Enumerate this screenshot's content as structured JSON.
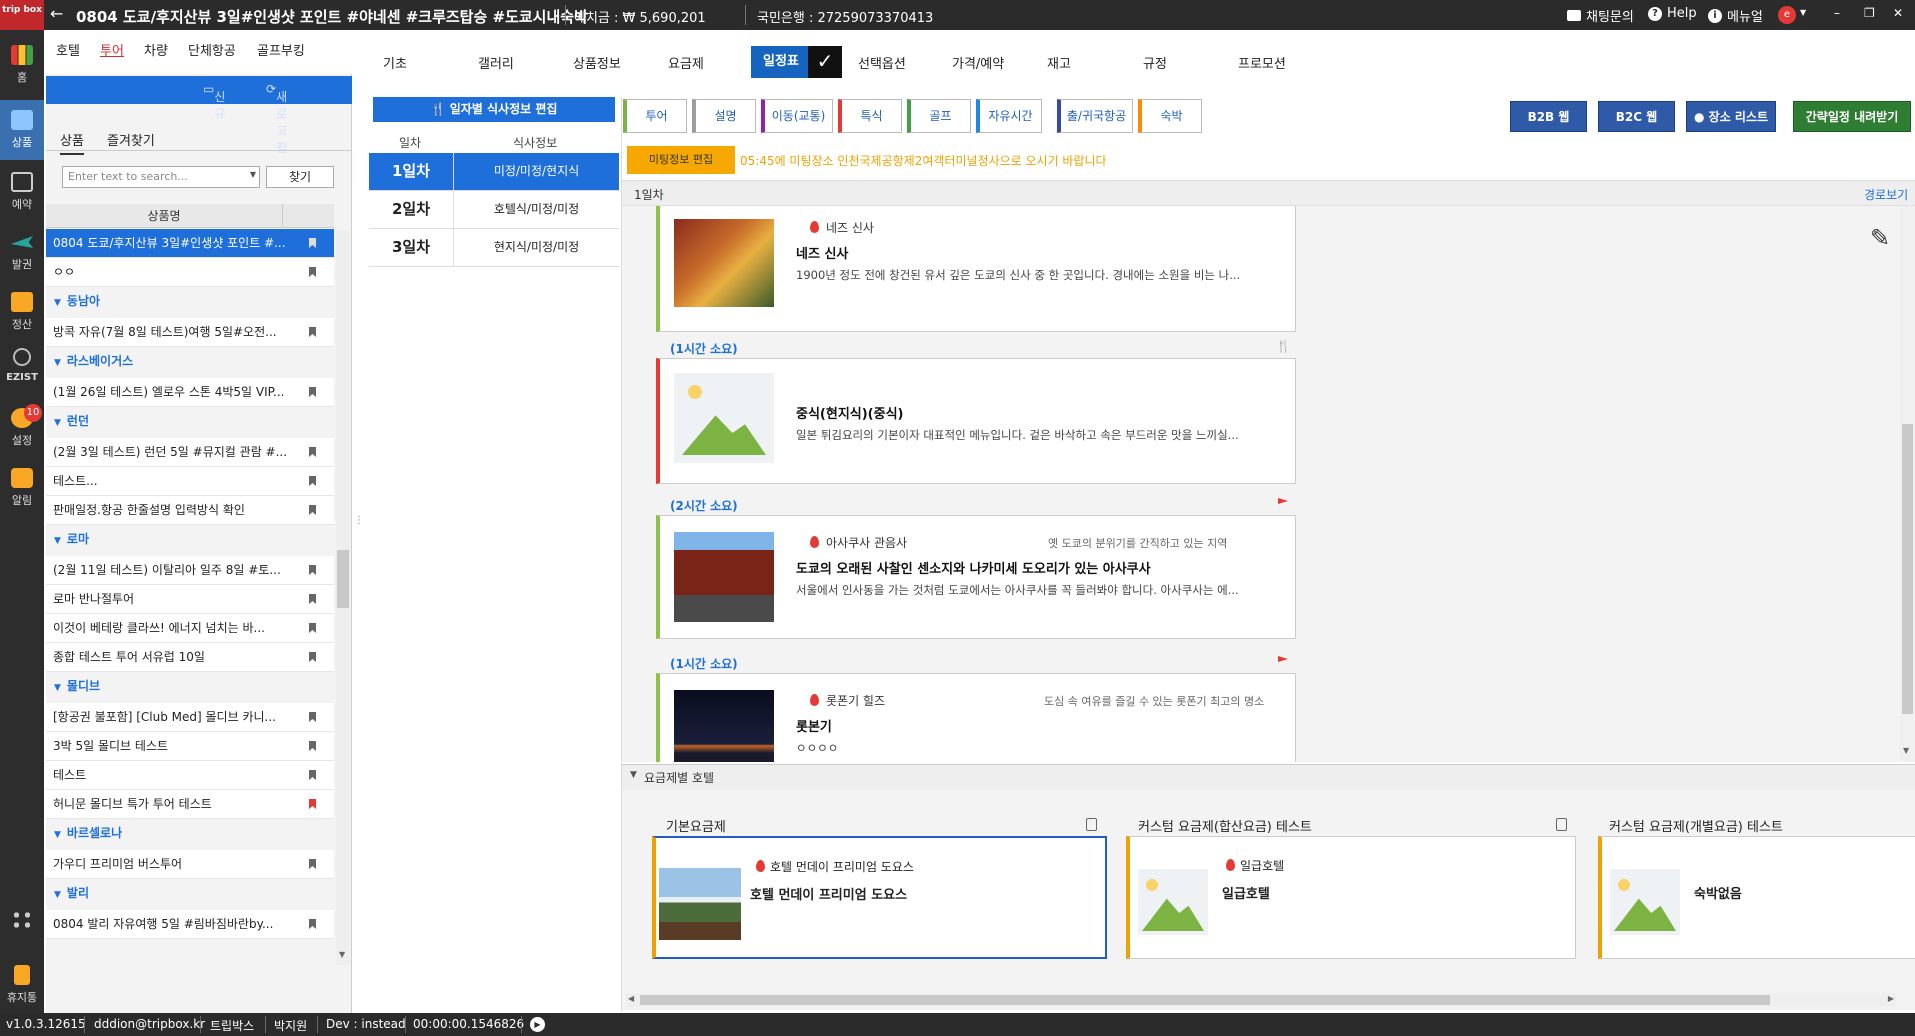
{
  "titlebar": {
    "logo": "trip box",
    "title": "0804 도쿄/후지산뷰 3일#인생샷 포인트 #야네센 #크루즈탑승 #도쿄시내숙박",
    "deposit": "예치금 : ₩ 5,690,201",
    "bank": "국민은행 : 27259073370413",
    "chat": "채팅문의",
    "help": "Help",
    "manual": "메뉴얼"
  },
  "rail": {
    "items": [
      {
        "label": "홈"
      },
      {
        "label": "상품"
      },
      {
        "label": "예약"
      },
      {
        "label": "발권"
      },
      {
        "label": "정산"
      },
      {
        "label": "EZIST"
      },
      {
        "label": "설정",
        "badge": "10"
      },
      {
        "label": "알림"
      },
      {
        "label": "휴지통"
      }
    ]
  },
  "category_tabs": [
    "호텔",
    "투어",
    "차량",
    "단체항공",
    "골프부킹"
  ],
  "top_tabs": [
    "기초",
    "갤러리",
    "상품정보",
    "요금제",
    "일정표",
    "선택옵션",
    "가격/예약",
    "재고",
    "규정",
    "프로모션"
  ],
  "left_panel": {
    "toolbar": {
      "new": "신규",
      "refresh": "새로고침"
    },
    "sub_tabs": [
      "상품",
      "즐겨찾기"
    ],
    "search_placeholder": "Enter text to search...",
    "search_button": "찾기",
    "column_header": "상품명",
    "rows": [
      {
        "type": "item",
        "text": "0804 도쿄/후지산뷰 3일#인생샷 포인트 #...",
        "selected": true
      },
      {
        "type": "item",
        "text": "ㅇㅇ"
      },
      {
        "type": "group",
        "text": "동남아"
      },
      {
        "type": "item",
        "text": "방콕 자유(7월 8일 테스트)여행 5일#오전..."
      },
      {
        "type": "group",
        "text": "라스베이거스"
      },
      {
        "type": "item",
        "text": "(1월 26일 테스트) 엘로우 스톤 4박5일 VIP..."
      },
      {
        "type": "group",
        "text": "런던"
      },
      {
        "type": "item",
        "text": "(2월 3일 테스트) 런던 5일 #뮤지컬 관람 #..."
      },
      {
        "type": "item",
        "text": "테스트..."
      },
      {
        "type": "item",
        "text": "판매일정.항공 한줄설명 입력방식 확인"
      },
      {
        "type": "group",
        "text": "로마"
      },
      {
        "type": "item",
        "text": "(2월 11일 테스트) 이탈리아 일주 8일 #토..."
      },
      {
        "type": "item",
        "text": "로마 반나절투어"
      },
      {
        "type": "item",
        "text": "이것이 베테랑 클라쓰! 에너지 넘치는 바..."
      },
      {
        "type": "item",
        "text": "종합 테스트 투어 서유럽 10일"
      },
      {
        "type": "group",
        "text": "몰디브"
      },
      {
        "type": "item",
        "text": "[항공권 불포함] [Club Med] 몰디브 카니..."
      },
      {
        "type": "item",
        "text": "3박 5일 몰디브 테스트"
      },
      {
        "type": "item",
        "text": "테스트"
      },
      {
        "type": "item",
        "text": "허니문 몰디브 특가 투어 테스트",
        "flag": "red"
      },
      {
        "type": "group",
        "text": "바르셀로나"
      },
      {
        "type": "item",
        "text": "가우디 프리미엄 버스투어"
      },
      {
        "type": "group",
        "text": "발리"
      },
      {
        "type": "item",
        "text": "0804 발리 자유여행 5일 #림바짐바란by..."
      }
    ]
  },
  "meal_panel": {
    "button": "일자별 식사정보 편집",
    "col_day": "일차",
    "col_info": "식사정보",
    "rows": [
      {
        "day": "1일차",
        "info": "미정/미정/현지식",
        "selected": true
      },
      {
        "day": "2일차",
        "info": "호텔식/미정/미정"
      },
      {
        "day": "3일차",
        "info": "현지식/미정/미정"
      }
    ]
  },
  "schedule": {
    "categories": [
      {
        "label": "투어",
        "color": "#7cb342"
      },
      {
        "label": "설명",
        "color": "#9e9e9e"
      },
      {
        "label": "이동(교통)",
        "color": "#8e24aa"
      },
      {
        "label": "특식",
        "color": "#e53935"
      },
      {
        "label": "골프",
        "color": "#43a047"
      },
      {
        "label": "자유시간",
        "color": "#1e88e5"
      },
      {
        "label": "출/귀국항공",
        "color": "#3949ab"
      },
      {
        "label": "숙박",
        "color": "#fb8c00"
      }
    ],
    "b2b": "B2B 웹",
    "b2c": "B2C 웹",
    "place_list": "장소 리스트",
    "download": "간략일정 내려받기",
    "meeting_button": "미팅정보 편집",
    "meeting_text": "05:45에 미팅장소 인천국제공항제2여객터미널정사으로 오시기 바랍니다",
    "day_label": "1일차",
    "route_link": "경로보기",
    "items": [
      {
        "location": "네즈 신사",
        "hint": "",
        "name": "네즈 신사",
        "desc": "1900년 정도 전에 창건된 유서 깊은 도쿄의 신사 중 한 곳입니다. 경내에는 소원을 비는 나...",
        "color": "#8bc34a"
      },
      {
        "duration": "(1시간 소요)",
        "location": "",
        "hint": "",
        "name": "중식(현지식)(중식)",
        "desc": "일본 튀김요리의 기본이자 대표적인 메뉴입니다. 겉은 바삭하고 속은 부드러운 맛을 느끼실...",
        "color": "#e53935"
      },
      {
        "duration": "(2시간 소요)",
        "location": "아사쿠사 관음사",
        "hint": "옛 도쿄의 분위기를 간직하고 있는 지역",
        "name": "도쿄의 오래된 사찰인 센소지와 나카미세 도오리가 있는 아사쿠사",
        "desc": "서울에서 인사동을 가는 것처럼 도쿄에서는 아사쿠사를 꼭 들러봐야 합니다. 아사쿠사는 에...",
        "color": "#8bc34a"
      },
      {
        "duration": "(1시간 소요)",
        "location": "롯폰기 힐즈",
        "hint": "도심 속 여유를 즐길 수 있는 롯폰기 최고의 명소",
        "name": "롯본기",
        "desc": "ㅇㅇㅇㅇ",
        "color": "#8bc34a"
      }
    ]
  },
  "hotels": {
    "section_label": "요금제별 호텔",
    "plans": [
      {
        "title": "기본요금제",
        "location": "호텔 먼데이 프리미엄 도요스",
        "name": "호텔 먼데이 프리미엄 도요스",
        "selected": true
      },
      {
        "title": "커스텀 요금제(합산요금) 테스트",
        "location": "일급호텔",
        "name": "일급호텔"
      },
      {
        "title": "커스텀 요금제(개별요금) 테스트",
        "location": "",
        "name": "숙박없음"
      }
    ]
  },
  "statusbar": {
    "version": "v1.0.3.12615",
    "user": "dddion@tripbox.kr",
    "company": "트립박스",
    "name": "박지원",
    "dev": "Dev : instead",
    "timer": "00:00:00.1546826"
  },
  "colors": {
    "accent": "#1e6fd9",
    "dark": "#2b2b2b",
    "orange": "#f6a800",
    "green_btn": "#2e7d32"
  }
}
